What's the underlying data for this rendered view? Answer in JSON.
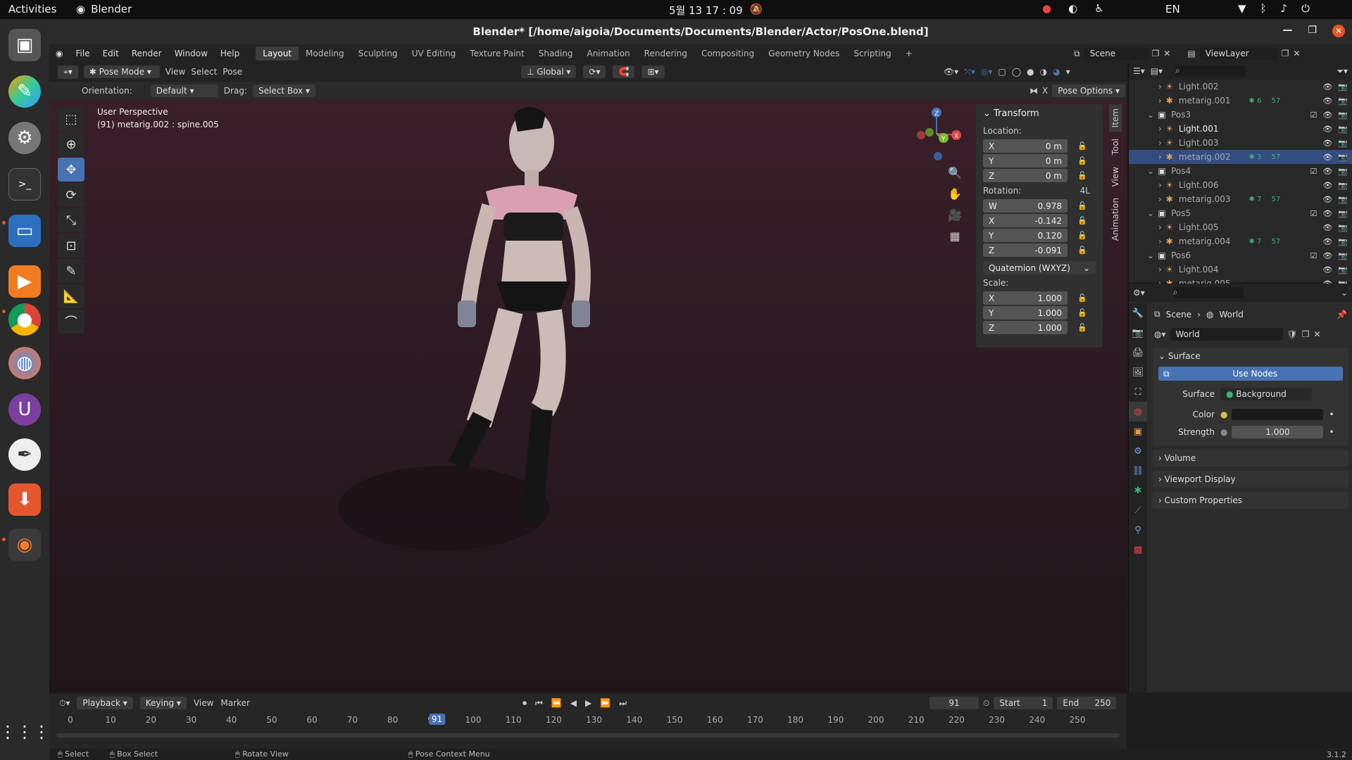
{
  "topbar": {
    "activities": "Activities",
    "app_name": "Blender",
    "clock": "5월 13  17 : 09",
    "lang": "EN"
  },
  "window": {
    "title": "Blender* [/home/aigoia/Documents/Documents/Blender/Actor/PosOne.blend]"
  },
  "menu": {
    "file": "File",
    "edit": "Edit",
    "render": "Render",
    "window": "Window",
    "help": "Help"
  },
  "workspaces": [
    "Layout",
    "Modeling",
    "Sculpting",
    "UV Editing",
    "Texture Paint",
    "Shading",
    "Animation",
    "Rendering",
    "Compositing",
    "Geometry Nodes",
    "Scripting"
  ],
  "add_workspace": "+",
  "scene": {
    "label": "Scene",
    "view_layer": "ViewLayer"
  },
  "header": {
    "mode": "Pose Mode",
    "view": "View",
    "select": "Select",
    "pose": "Pose",
    "transform_space": "Global",
    "pose_options": "Pose Options"
  },
  "header2": {
    "orientation_label": "Orientation:",
    "orientation_value": "Default",
    "drag_label": "Drag:",
    "drag_value": "Select Box"
  },
  "viewport": {
    "perspective": "User Perspective",
    "object": "(91) metarig.002 : spine.005"
  },
  "transform": {
    "title": "Transform",
    "location_label": "Location:",
    "loc": {
      "x": "0 m",
      "y": "0 m",
      "z": "0 m"
    },
    "rotation_label": "Rotation:",
    "rotation_mode_short": "4L",
    "rot": {
      "w": "0.978",
      "x": "-0.142",
      "y": "0.120",
      "z": "-0.091"
    },
    "rotation_mode": "Quaternion (WXYZ)",
    "scale_label": "Scale:",
    "scale": {
      "x": "1.000",
      "y": "1.000",
      "z": "1.000"
    },
    "axis": {
      "w": "W",
      "x": "X",
      "y": "Y",
      "z": "Z"
    }
  },
  "sidetabs": {
    "item": "Item",
    "tool": "Tool",
    "view": "View",
    "animation": "Animation"
  },
  "outliner": {
    "rows": [
      {
        "name": "Light.002",
        "indent": 2,
        "type": "light"
      },
      {
        "name": "metarig.001",
        "indent": 2,
        "type": "armature",
        "b1": "6",
        "b2": "57"
      },
      {
        "name": "Pos3",
        "indent": 1,
        "type": "collection"
      },
      {
        "name": "Light.001",
        "indent": 2,
        "type": "light"
      },
      {
        "name": "Light.003",
        "indent": 2,
        "type": "light"
      },
      {
        "name": "metarig.002",
        "indent": 2,
        "type": "armature",
        "sel": true,
        "b1": "3",
        "b2": "57"
      },
      {
        "name": "Pos4",
        "indent": 1,
        "type": "collection"
      },
      {
        "name": "Light.006",
        "indent": 2,
        "type": "light"
      },
      {
        "name": "metarig.003",
        "indent": 2,
        "type": "armature",
        "b1": "7",
        "b2": "57"
      },
      {
        "name": "Pos5",
        "indent": 1,
        "type": "collection"
      },
      {
        "name": "Light.005",
        "indent": 2,
        "type": "light"
      },
      {
        "name": "metarig.004",
        "indent": 2,
        "type": "armature",
        "b1": "7",
        "b2": "57"
      },
      {
        "name": "Pos6",
        "indent": 1,
        "type": "collection"
      },
      {
        "name": "Light.004",
        "indent": 2,
        "type": "light"
      },
      {
        "name": "metarig.005",
        "indent": 2,
        "type": "armature"
      }
    ]
  },
  "properties": {
    "breadcrumb_scene": "Scene",
    "breadcrumb_world": "World",
    "world_name": "World",
    "surface_section": "Surface",
    "use_nodes": "Use Nodes",
    "surface_label": "Surface",
    "surface_value": "Background",
    "color_label": "Color",
    "strength_label": "Strength",
    "strength_value": "1.000",
    "volume": "Volume",
    "viewport_display": "Viewport Display",
    "custom_properties": "Custom Properties"
  },
  "timeline": {
    "playback": "Playback",
    "keying": "Keying",
    "view": "View",
    "marker": "Marker",
    "current_frame": "91",
    "start_label": "Start",
    "start": "1",
    "end_label": "End",
    "end": "250",
    "ticks": [
      "0",
      "10",
      "20",
      "30",
      "40",
      "50",
      "60",
      "70",
      "80",
      "90",
      "100",
      "110",
      "120",
      "130",
      "140",
      "150",
      "160",
      "170",
      "180",
      "190",
      "200",
      "210",
      "220",
      "230",
      "240",
      "250"
    ]
  },
  "status": {
    "select": "Select",
    "box_select": "Box Select",
    "rotate_view": "Rotate View",
    "pose_context": "Pose Context Menu",
    "version": "3.1.2"
  },
  "colors": {
    "accent": "#4772b3",
    "ubuntu_orange": "#e95420"
  }
}
